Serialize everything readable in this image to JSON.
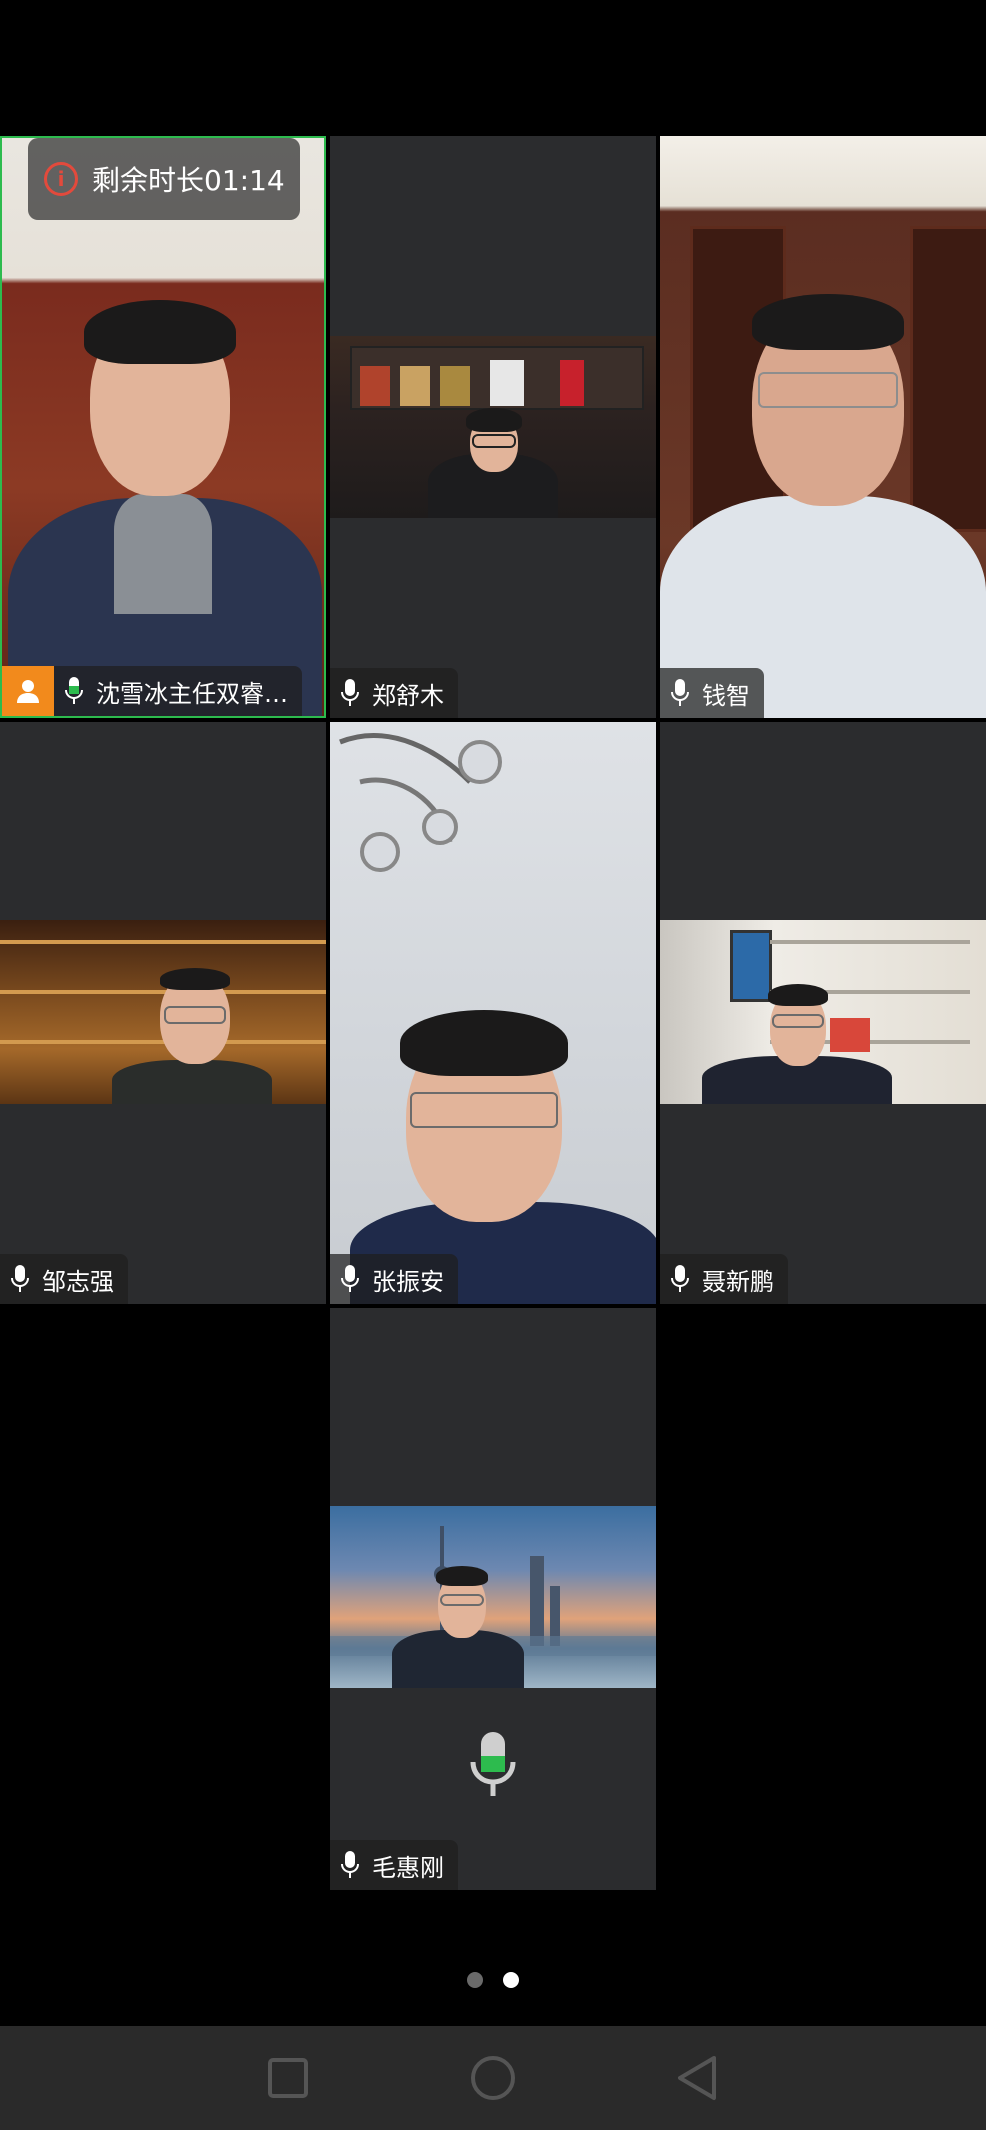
{
  "timer": {
    "text": "剩余时长01:14",
    "icon": "info-icon"
  },
  "participants": [
    {
      "name": "沈雪冰主任双睿…",
      "active": true,
      "host": true
    },
    {
      "name": "郑舒木"
    },
    {
      "name": "钱智"
    },
    {
      "name": "邹志强"
    },
    {
      "name": "张振安"
    },
    {
      "name": "聂新鹏"
    },
    {
      "name": "毛惠刚",
      "audio_only_icon": "microphone-icon"
    }
  ],
  "pagination": {
    "total_pages": 2,
    "current_page": 2
  },
  "nav_buttons": [
    "recents-square-icon",
    "home-circle-icon",
    "back-triangle-icon"
  ],
  "colors": {
    "active_border": "#2dbb4e",
    "host_badge": "#f28a1c",
    "timer_icon": "#e34a3c",
    "mic_level": "#2dbb4e"
  }
}
